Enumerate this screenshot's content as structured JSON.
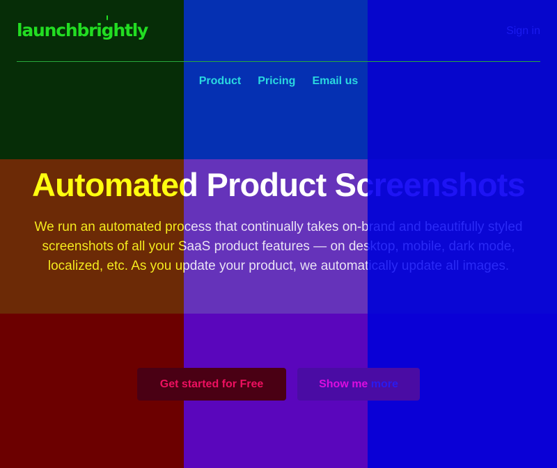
{
  "brand": {
    "name": "launchbrightly",
    "color": "#22dd22"
  },
  "header": {
    "sign_in": "Sign in",
    "divider_color": "#28aa3c"
  },
  "nav": {
    "color": "#2ad8e0",
    "items": [
      "Product",
      "Pricing",
      "Email us"
    ]
  },
  "hero": {
    "title": "Automated Product Screenshots",
    "description": "We run an automated process that continually takes on-brand and beautifully styled screenshots of all your SaaS product features — on desktop, mobile, dark mode, localized, etc. As you update your product, we automatically update all images."
  },
  "cta": {
    "primary_label": "Get started for Free",
    "secondary_label": "Show me more"
  },
  "panels": {
    "rows": [
      [
        {
          "bg": "#062d07",
          "fg": "#22dd22"
        },
        {
          "bg": "#0530b2",
          "fg": "#2ad8e0"
        },
        {
          "bg": "#0606cc",
          "fg": "#1a1af0"
        }
      ],
      [
        {
          "bg": "#6c2a06",
          "fg": "#f8ee1e"
        },
        {
          "bg": "#6533ba",
          "fg": "#ece6f6"
        },
        {
          "bg": "#0a06d4",
          "fg": "#2a2af6"
        }
      ],
      [
        {
          "bg": "#6c0000",
          "fg": "#ee1060"
        },
        {
          "bg": "#5a06bc",
          "fg": "#dd0ce0"
        },
        {
          "bg": "#0a00d6",
          "fg": "#2a1af0"
        }
      ]
    ],
    "title_colors": [
      "#ffff10",
      "#ffffff",
      "#1e14f4"
    ],
    "cta_primary_bg": "#4a0014",
    "cta_secondary_bg": "#4a0ca4"
  }
}
